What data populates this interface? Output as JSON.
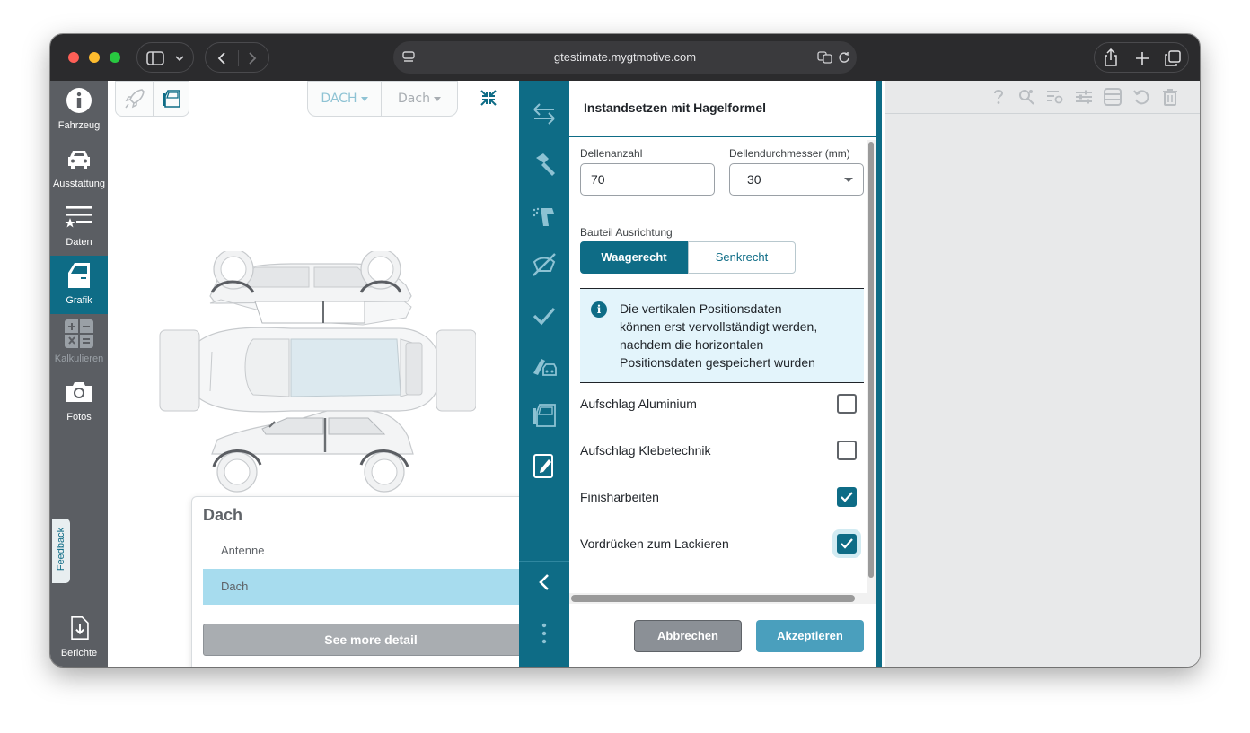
{
  "browser": {
    "url": "gtestimate.mygtmotive.com"
  },
  "nav": {
    "items": [
      {
        "label": "Fahrzeug"
      },
      {
        "label": "Ausstattung"
      },
      {
        "label": "Daten"
      },
      {
        "label": "Grafik"
      },
      {
        "label": "Kalkulieren"
      },
      {
        "label": "Fotos"
      }
    ],
    "feedback": "Feedback",
    "reports": "Berichte"
  },
  "graphic": {
    "zone_select": "DACH",
    "part_select": "Dach",
    "popup": {
      "title": "Dach",
      "items": [
        "Antenne",
        "Dach"
      ],
      "selected_index": 1,
      "more_button": "See more detail"
    }
  },
  "dialog": {
    "title": "Instandsetzen mit Hagelformel",
    "dent_count_label": "Dellenanzahl",
    "dent_count_value": "70",
    "dent_diameter_label": "Dellendurchmesser (mm)",
    "dent_diameter_value": "30",
    "orientation_label": "Bauteil Ausrichtung",
    "orientation_options": [
      "Waagerecht",
      "Senkrecht"
    ],
    "orientation_selected": "Waagerecht",
    "info_lines": [
      "Die vertikalen Positionsdaten",
      "können erst vervollständigt werden,",
      "nachdem die horizontalen",
      "Positionsdaten gespeichert wurden"
    ],
    "checkboxes": [
      {
        "label": "Aufschlag Aluminium",
        "checked": false
      },
      {
        "label": "Aufschlag Klebetechnik",
        "checked": false
      },
      {
        "label": "Finisharbeiten",
        "checked": true
      },
      {
        "label": "Vordrücken zum Lackieren",
        "checked": true
      }
    ],
    "cancel_label": "Abbrechen",
    "accept_label": "Akzeptieren"
  },
  "colors": {
    "primary": "#0e6c86",
    "nav_bg": "#5b5e63",
    "selected_row": "#a7dcee",
    "accept_button": "#4a9fbd",
    "info_bg": "#e3f4fb"
  }
}
